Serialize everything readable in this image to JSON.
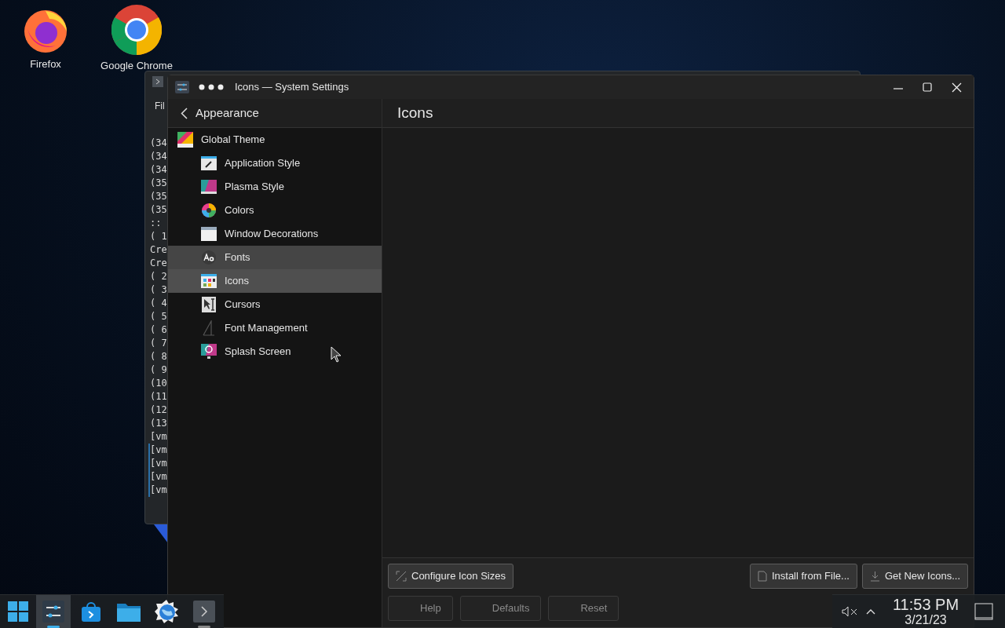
{
  "desktop_icons": [
    {
      "label": "Firefox"
    },
    {
      "label": "Google Chrome"
    }
  ],
  "terminal_window": {
    "menu": "Fil",
    "lines": [
      "(34",
      "(34",
      "(34",
      "(35",
      "(35",
      "(35",
      "::",
      "( 1",
      "Cre",
      "Cre",
      "( 2",
      "( 3",
      "( 4",
      "( 5",
      "( 6",
      "( 7",
      "( 8",
      "( 9",
      "(10",
      "(11",
      "(12",
      "(13",
      "[vm",
      "[vm",
      "[vm",
      "[vm",
      "[vm"
    ]
  },
  "settings_window": {
    "title": "Icons — System Settings",
    "sidebar": {
      "header": "Appearance",
      "items": [
        {
          "label": "Global Theme",
          "selected": false,
          "hovered": false,
          "children": [
            {
              "label": "Application Style",
              "selected": false,
              "hovered": false
            },
            {
              "label": "Plasma Style",
              "selected": false,
              "hovered": false
            },
            {
              "label": "Colors",
              "selected": false,
              "hovered": false
            },
            {
              "label": "Window Decorations",
              "selected": false,
              "hovered": false
            },
            {
              "label": "Fonts",
              "selected": false,
              "hovered": true
            },
            {
              "label": "Icons",
              "selected": true,
              "hovered": false
            },
            {
              "label": "Cursors",
              "selected": false,
              "hovered": false
            },
            {
              "label": "Font Management",
              "selected": false,
              "hovered": false
            },
            {
              "label": "Splash Screen",
              "selected": false,
              "hovered": false
            }
          ]
        }
      ]
    },
    "page": {
      "title": "Icons",
      "left_buttons": [
        {
          "label": "Configure Icon Sizes",
          "disabled": false
        }
      ],
      "right_buttons": [
        {
          "label": "Install from File...",
          "disabled": false
        },
        {
          "label": "Get New Icons...",
          "disabled": false
        }
      ],
      "footer_buttons": [
        {
          "label": "Help",
          "disabled": true
        },
        {
          "label": "Defaults",
          "disabled": true
        },
        {
          "label": "Reset",
          "disabled": true
        }
      ]
    }
  },
  "taskbar": {
    "tasks": [
      {
        "selected": true,
        "open": true
      },
      {
        "selected": false,
        "open": false
      },
      {
        "selected": false,
        "open": false
      },
      {
        "selected": false,
        "open": false
      },
      {
        "selected": false,
        "open": true
      }
    ],
    "clock": {
      "time": "11:53 PM",
      "date": "3/21/23"
    }
  }
}
